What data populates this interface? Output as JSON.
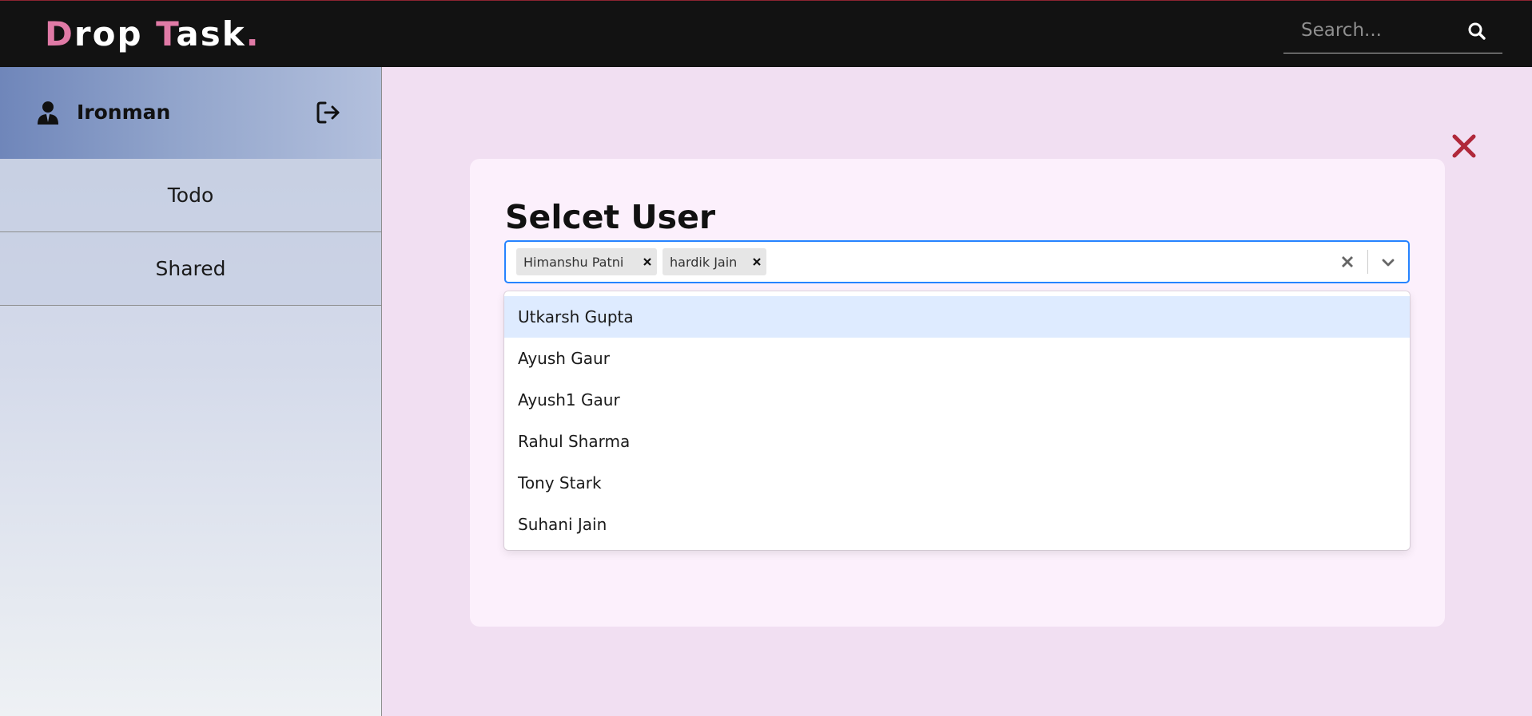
{
  "header": {
    "logo": {
      "part1_accent": "D",
      "part2": "rop ",
      "part3_accent": "T",
      "part4": "ask",
      "part5_accent": "."
    },
    "search": {
      "placeholder": "Search...",
      "value": "",
      "icon": "search-icon"
    },
    "colors": {
      "background": "#121212",
      "logo_accent": "#e07aa6"
    }
  },
  "sidebar": {
    "user": {
      "name": "Ironman",
      "icon": "user-icon",
      "logout_icon": "logout-icon"
    },
    "items": [
      {
        "label": "Todo"
      },
      {
        "label": "Shared"
      }
    ]
  },
  "modal": {
    "title": "Selcet User",
    "close_icon": "close-icon",
    "select": {
      "selected": [
        {
          "label": "Himanshu Patni"
        },
        {
          "label": "hardik Jain"
        }
      ],
      "clear_icon": "clear-icon",
      "dropdown_icon": "chevron-down-icon",
      "options": [
        {
          "label": "Utkarsh Gupta",
          "focused": true
        },
        {
          "label": "Ayush Gaur",
          "focused": false
        },
        {
          "label": "Ayush1 Gaur",
          "focused": false
        },
        {
          "label": "Rahul Sharma",
          "focused": false
        },
        {
          "label": "Tony Stark",
          "focused": false
        },
        {
          "label": "Suhani Jain",
          "focused": false
        }
      ]
    },
    "colors": {
      "focus_border": "#2684ff",
      "option_focus": "#deebff",
      "close": "#b0283a"
    }
  }
}
